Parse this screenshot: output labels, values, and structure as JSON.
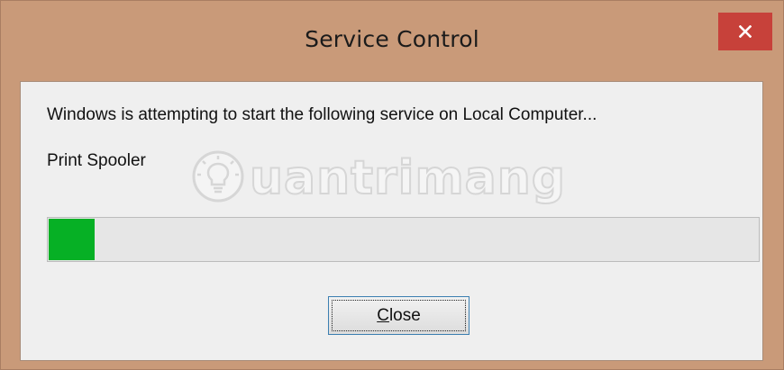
{
  "window": {
    "title": "Service Control",
    "close_icon": "close-icon",
    "title_bar_color": "#c99a79",
    "close_button_color": "#c7413a"
  },
  "dialog": {
    "message": "Windows is attempting to start the following service on Local Computer...",
    "service_name": "Print Spooler",
    "progress": {
      "fraction": 0.065,
      "fill_color": "#06b025"
    },
    "close_button": {
      "mnemonic": "C",
      "rest": "lose"
    }
  },
  "watermark": {
    "text": "uantrimang",
    "icon": "lightbulb-icon"
  }
}
